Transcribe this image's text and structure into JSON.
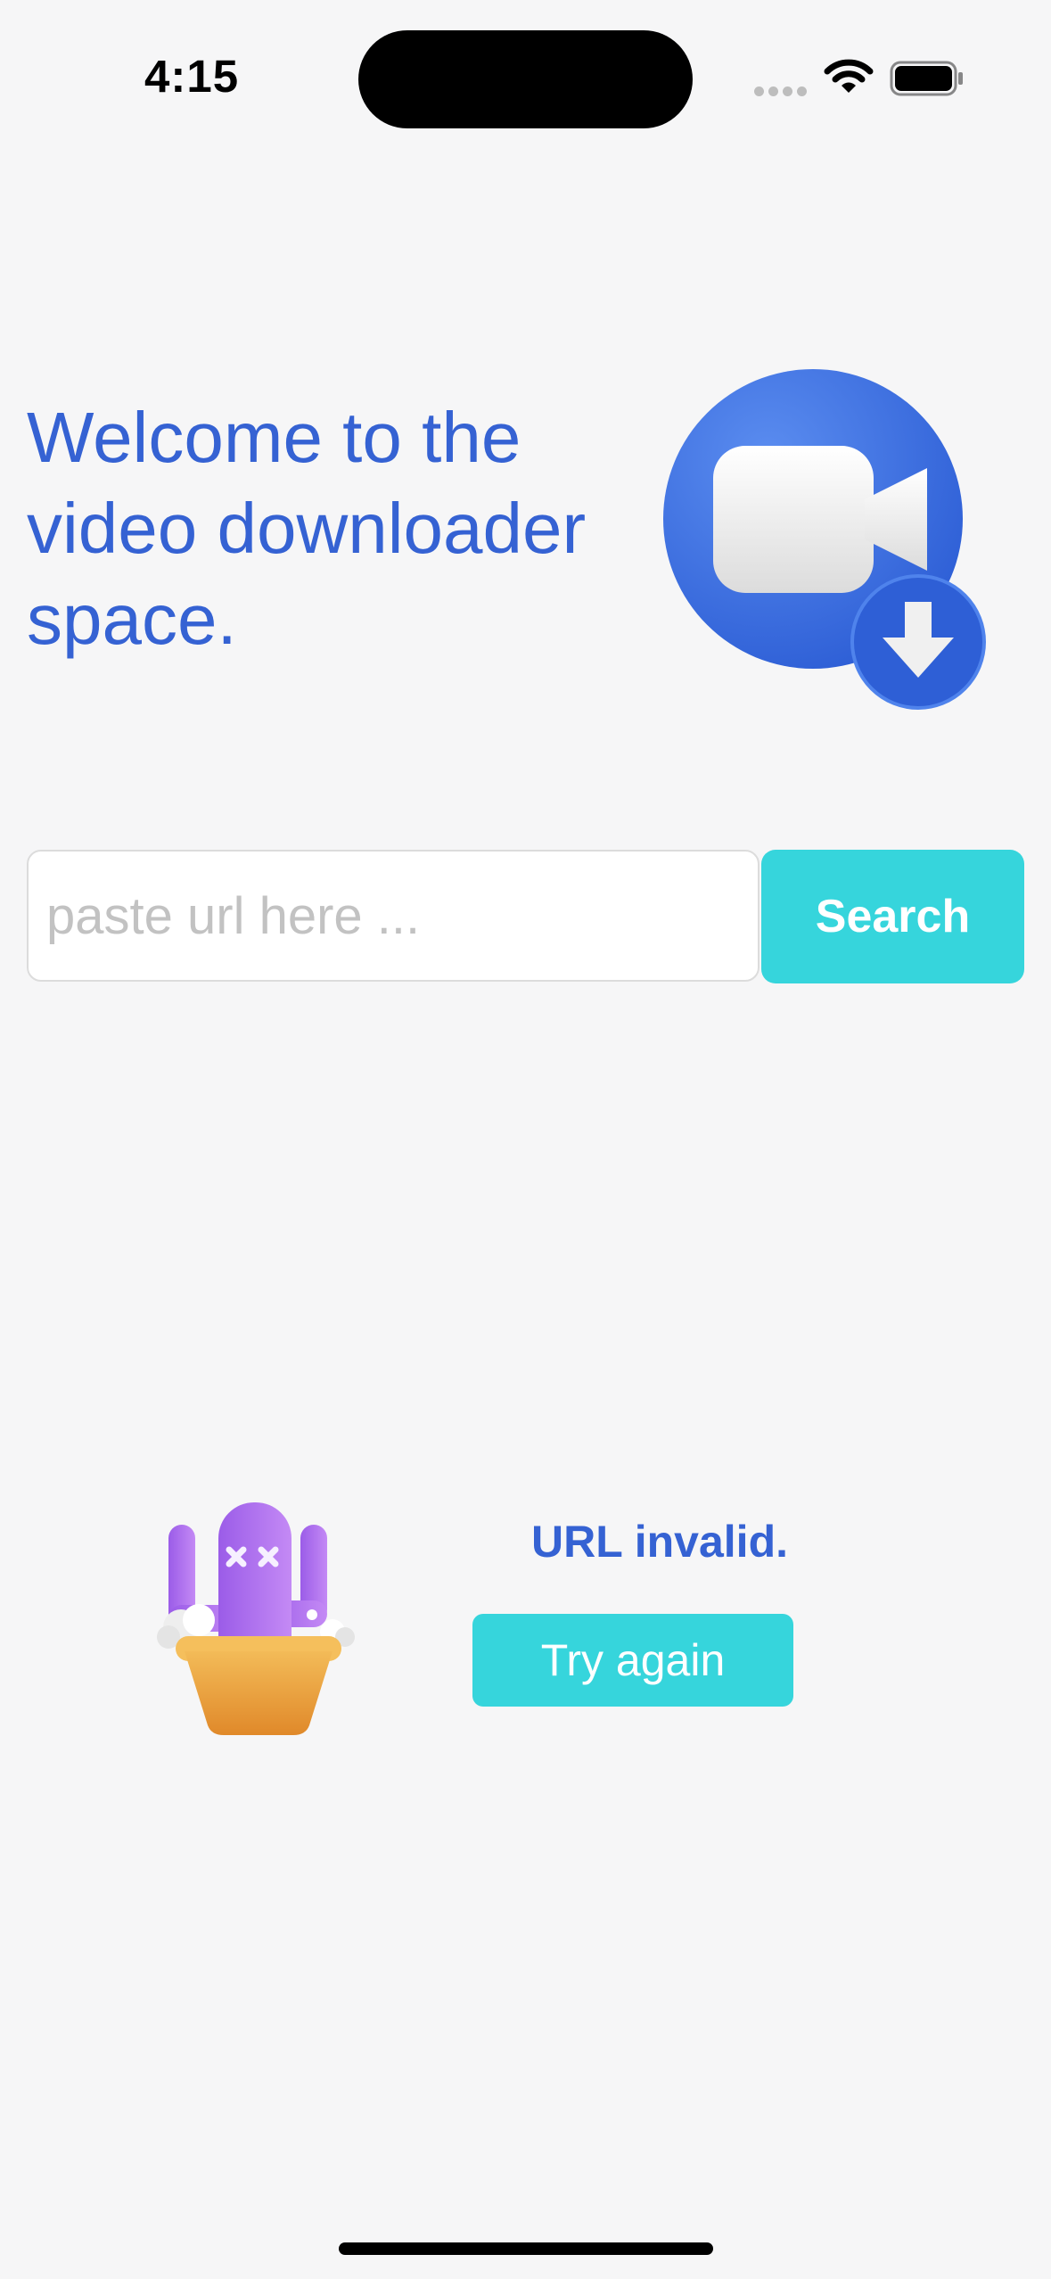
{
  "status_bar": {
    "time": "4:15",
    "icons": [
      "signal-dots-icon",
      "wifi-icon",
      "battery-icon"
    ]
  },
  "welcome": {
    "title": "Welcome to the video downloader space.",
    "hero_icon": "video-download-icon"
  },
  "search": {
    "placeholder": "paste url here ...",
    "value": "",
    "button_label": "Search"
  },
  "error": {
    "illustration": "cactus-icon",
    "message": "URL invalid.",
    "retry_label": "Try again"
  },
  "colors": {
    "accent_blue": "#3562d3",
    "button_cyan": "#36d5dc",
    "background": "#f6f6f7"
  }
}
